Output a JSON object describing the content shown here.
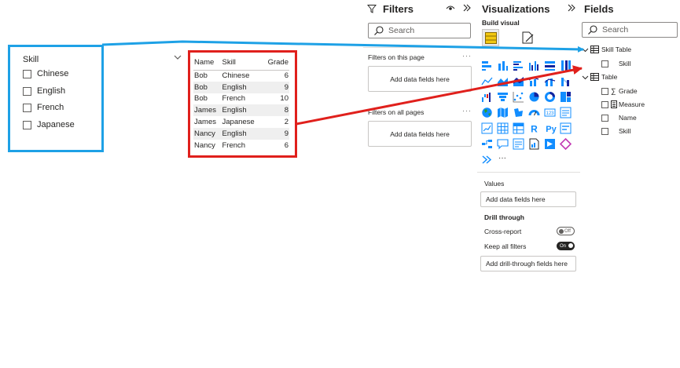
{
  "canvas": {
    "slicer": {
      "title": "Skill",
      "items": [
        "Chinese",
        "English",
        "French",
        "Japanese"
      ]
    },
    "table": {
      "headers": [
        "Name",
        "Skill",
        "Grade"
      ],
      "rows": [
        [
          "Bob",
          "Chinese",
          "6"
        ],
        [
          "Bob",
          "English",
          "9"
        ],
        [
          "Bob",
          "French",
          "10"
        ],
        [
          "James",
          "English",
          "8"
        ],
        [
          "James",
          "Japanese",
          "2"
        ],
        [
          "Nancy",
          "English",
          "9"
        ],
        [
          "Nancy",
          "French",
          "6"
        ]
      ]
    }
  },
  "filters_pane": {
    "title": "Filters",
    "search_placeholder": "Search",
    "on_page_label": "Filters on this page",
    "on_page_well": "Add data fields here",
    "all_pages_label": "Filters on all pages",
    "all_pages_well": "Add data fields here",
    "more": "···"
  },
  "viz_pane": {
    "title": "Visualizations",
    "build_visual": "Build visual",
    "values_label": "Values",
    "values_well": "Add data fields here",
    "drill_through": "Drill through",
    "cross_report": "Cross-report",
    "cross_report_state": "Off",
    "keep_all_filters": "Keep all filters",
    "keep_all_filters_state": "On",
    "drill_well": "Add drill-through fields here",
    "more": "···"
  },
  "fields_pane": {
    "title": "Fields",
    "search_placeholder": "Search",
    "tables": [
      {
        "name": "Skill Table",
        "fields": [
          "Skill"
        ]
      },
      {
        "name": "Table",
        "fields": [
          "Grade",
          "Measure",
          "Name",
          "Skill"
        ]
      }
    ]
  },
  "colors": {
    "slicer_highlight": "#1ea1e6",
    "table_highlight": "#e0201c",
    "accent_yellow": "#f2c811"
  }
}
